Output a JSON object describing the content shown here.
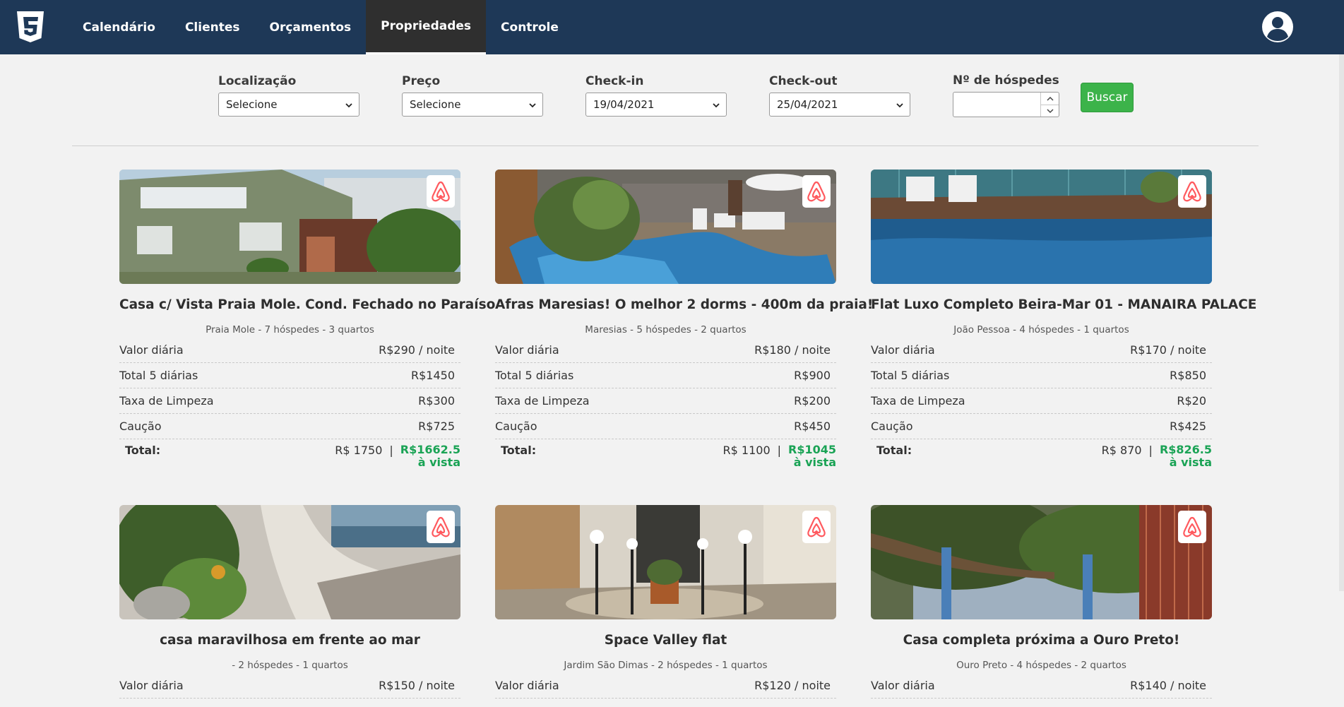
{
  "nav": {
    "items": [
      {
        "label": "Calendário",
        "active": false
      },
      {
        "label": "Clientes",
        "active": false
      },
      {
        "label": "Orçamentos",
        "active": false
      },
      {
        "label": "Propriedades",
        "active": true
      },
      {
        "label": "Controle",
        "active": false
      }
    ],
    "logo_icon": "css3-logo-icon",
    "account_icon": "user-circle-icon"
  },
  "filters": {
    "location": {
      "label": "Localização",
      "value": "Selecione"
    },
    "price": {
      "label": "Preço",
      "value": "Selecione"
    },
    "checkin": {
      "label": "Check-in",
      "value": "19/04/2021"
    },
    "checkout": {
      "label": "Check-out",
      "value": "25/04/2021"
    },
    "guests": {
      "label": "Nº de hóspedes",
      "value": ""
    },
    "search_label": "Buscar"
  },
  "properties": [
    {
      "title": "Casa c/ Vista Praia Mole. Cond. Fechado no Paraíso",
      "subtitle": "Praia Mole - 7 hóspedes - 3 quartos",
      "rows": [
        {
          "label": "Valor diária",
          "value": "R$290 / noite"
        },
        {
          "label": "Total 5 diárias",
          "value": "R$1450"
        },
        {
          "label": "Taxa de Limpeza",
          "value": "R$300"
        },
        {
          "label": "Caução",
          "value": "R$725"
        }
      ],
      "total_label": "Total:",
      "total_value": "R$ 1750",
      "separator": "|",
      "cash_value": "R$1662.5",
      "cash_note": "à vista"
    },
    {
      "title": "Afras Maresias! O melhor 2 dorms - 400m da praia!",
      "subtitle": "Maresias - 5 hóspedes - 2 quartos",
      "rows": [
        {
          "label": "Valor diária",
          "value": "R$180 / noite"
        },
        {
          "label": "Total 5 diárias",
          "value": "R$900"
        },
        {
          "label": "Taxa de Limpeza",
          "value": "R$200"
        },
        {
          "label": "Caução",
          "value": "R$450"
        }
      ],
      "total_label": "Total:",
      "total_value": "R$ 1100",
      "separator": "|",
      "cash_value": "R$1045",
      "cash_note": "à vista"
    },
    {
      "title": "Flat Luxo Completo Beira-Mar 01 - MANAIRA PALACE",
      "subtitle": "João Pessoa - 4 hóspedes - 1 quartos",
      "rows": [
        {
          "label": "Valor diária",
          "value": "R$170 / noite"
        },
        {
          "label": "Total 5 diárias",
          "value": "R$850"
        },
        {
          "label": "Taxa de Limpeza",
          "value": "R$20"
        },
        {
          "label": "Caução",
          "value": "R$425"
        }
      ],
      "total_label": "Total:",
      "total_value": "R$ 870",
      "separator": "|",
      "cash_value": "R$826.5",
      "cash_note": "à vista"
    },
    {
      "title": "casa maravilhosa em frente ao mar",
      "subtitle": " - 2 hóspedes - 1 quartos",
      "rows": [
        {
          "label": "Valor diária",
          "value": "R$150 / noite"
        }
      ]
    },
    {
      "title": "Space Valley flat",
      "subtitle": "Jardim São Dimas - 2 hóspedes - 1 quartos",
      "rows": [
        {
          "label": "Valor diária",
          "value": "R$120 / noite"
        }
      ]
    },
    {
      "title": "Casa completa próxima a Ouro Preto!",
      "subtitle": "Ouro Preto - 4 hóspedes - 2 quartos",
      "rows": [
        {
          "label": "Valor diária",
          "value": "R$140 / noite"
        }
      ]
    }
  ],
  "badge_icon": "airbnb-icon",
  "colors": {
    "topbar": "#1e3857",
    "active_tab": "#2f2f2f",
    "search_button": "#3cb34a",
    "cash_price": "#1aa355",
    "airbnb": "#ff5a5f"
  }
}
